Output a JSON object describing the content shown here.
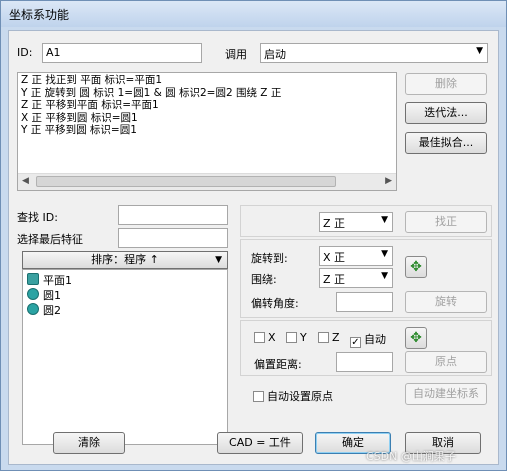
{
  "window": {
    "title": "坐标系功能"
  },
  "id": {
    "label": "ID:",
    "value": "A1"
  },
  "invoke": {
    "label": "调用",
    "value": "启动"
  },
  "commands": [
    "Z 正 找正到 平面 标识=平面1",
    "Y 正 旋转到 圆 标识 1=圆1 & 圆 标识2=圆2 围绕 Z 正",
    "Z 正 平移到平面 标识=平面1",
    "X 正 平移到圆 标识=圆1",
    "Y 正 平移到圆 标识=圆1"
  ],
  "buttons": {
    "delete": "删除",
    "iterative": "迭代法...",
    "bestfit": "最佳拟合...",
    "level": "找正",
    "rotate": "旋转",
    "origin": "原点",
    "auto_create": "自动建坐标系",
    "clear": "清除",
    "cad_equals_part": "CAD = 工件",
    "ok": "确定",
    "cancel": "取消"
  },
  "find": {
    "label": "查找 ID:",
    "value": ""
  },
  "select_last": {
    "label": "选择最后特征",
    "value": ""
  },
  "sort": {
    "label": "排序：程序 ↑"
  },
  "features": [
    {
      "name": "平面1",
      "icon": "plane-feature-icon"
    },
    {
      "name": "圆1",
      "icon": "circle-feature-icon"
    },
    {
      "name": "圆2",
      "icon": "circle-feature-icon"
    }
  ],
  "level_axis": {
    "value": "Z 正"
  },
  "rotate_to": {
    "label": "旋转到:",
    "value": "X 正"
  },
  "around": {
    "label": "围绕:",
    "value": "Z 正"
  },
  "offset_angle": {
    "label": "偏转角度:",
    "value": ""
  },
  "axes": [
    {
      "label": "X",
      "checked": false
    },
    {
      "label": "Y",
      "checked": false
    },
    {
      "label": "Z",
      "checked": false
    },
    {
      "label": "自动",
      "checked": true
    }
  ],
  "offset_distance": {
    "label": "偏置距离:",
    "value": ""
  },
  "auto_origin": {
    "label": "自动设置原点",
    "checked": false
  },
  "watermark": "CSDN @山涧果子"
}
